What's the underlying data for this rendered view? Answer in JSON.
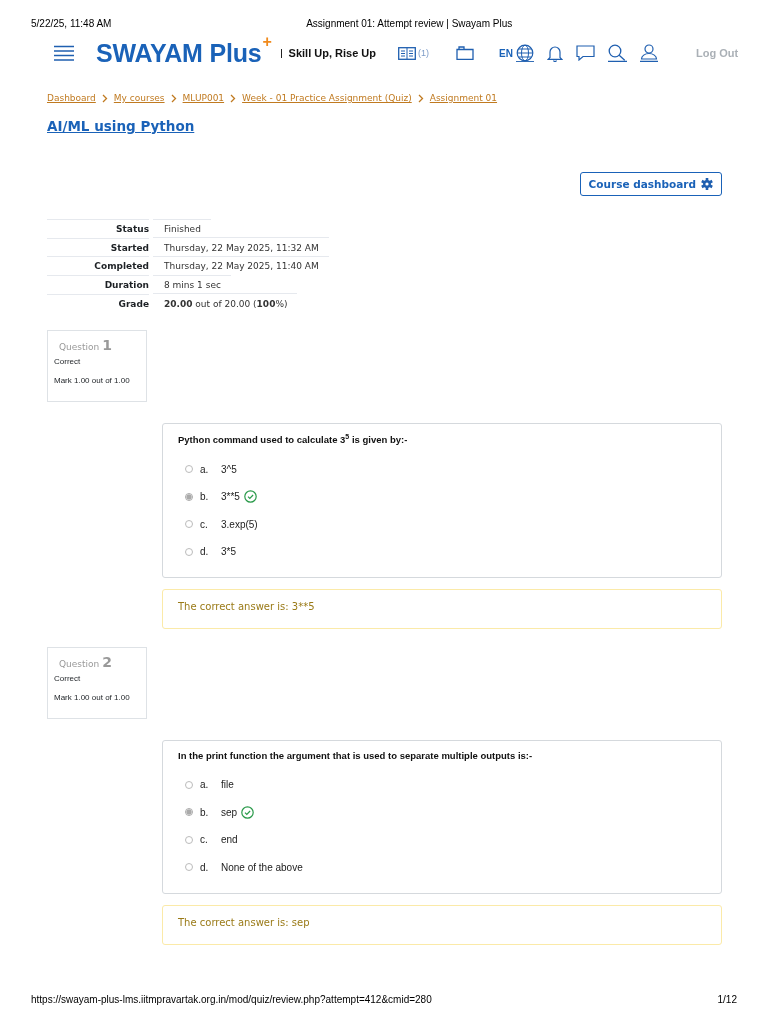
{
  "print_header": {
    "date": "5/22/25, 11:48 AM",
    "title": "Assignment 01: Attempt review | Swayam Plus"
  },
  "navbar": {
    "logo": "SWAYAM Plus",
    "logo_mark": "+",
    "tagline": "Skill Up, Rise Up",
    "book_count": "(1)",
    "language": "EN",
    "logout": "Log Out"
  },
  "breadcrumbs": [
    "Dashboard",
    "My courses",
    "MLUP001",
    "Week - 01 Practice Assignment (Quiz)",
    "Assignment 01"
  ],
  "course_title": "AI/ML using Python",
  "course_dashboard_button": "Course dashboard",
  "summary": [
    {
      "label": "Status",
      "value": "Finished"
    },
    {
      "label": "Started",
      "value": "Thursday, 22 May 2025, 11:32 AM"
    },
    {
      "label": "Completed",
      "value": "Thursday, 22 May 2025, 11:40 AM"
    },
    {
      "label": "Duration",
      "value": "8 mins 1 sec"
    },
    {
      "label": "Grade",
      "value": "**20.00** out of 20.00 (**100**%)"
    }
  ],
  "questions": [
    {
      "label": "Question",
      "number": "1",
      "state": "Correct",
      "mark": "Mark 1.00 out of 1.00",
      "text": "Python command used to calculate 3$^{5}$ is given by:-",
      "options": [
        {
          "letter": "a.",
          "text": "3^5",
          "selected": false,
          "correct": false
        },
        {
          "letter": "b.",
          "text": "3**5",
          "selected": true,
          "correct": true
        },
        {
          "letter": "c.",
          "text": "3.exp(5)",
          "selected": false,
          "correct": false
        },
        {
          "letter": "d.",
          "text": "3*5",
          "selected": false,
          "correct": false
        }
      ],
      "feedback": "The correct answer is: 3**5"
    },
    {
      "label": "Question",
      "number": "2",
      "state": "Correct",
      "mark": "Mark 1.00 out of 1.00",
      "text": "In the print function the argument that is used to separate multiple outputs is:-",
      "options": [
        {
          "letter": "a.",
          "text": "file",
          "selected": false,
          "correct": false
        },
        {
          "letter": "b.",
          "text": "sep",
          "selected": true,
          "correct": true
        },
        {
          "letter": "c.",
          "text": "end",
          "selected": false,
          "correct": false
        },
        {
          "letter": "d.",
          "text": "None of the above",
          "selected": false,
          "correct": false
        }
      ],
      "feedback": "The correct answer is: sep"
    }
  ],
  "print_footer": {
    "url": "https://swayam-plus-lms.iitmpravartak.org.in/mod/quiz/review.php?attempt=412&cmid=280",
    "page": "1/12"
  }
}
